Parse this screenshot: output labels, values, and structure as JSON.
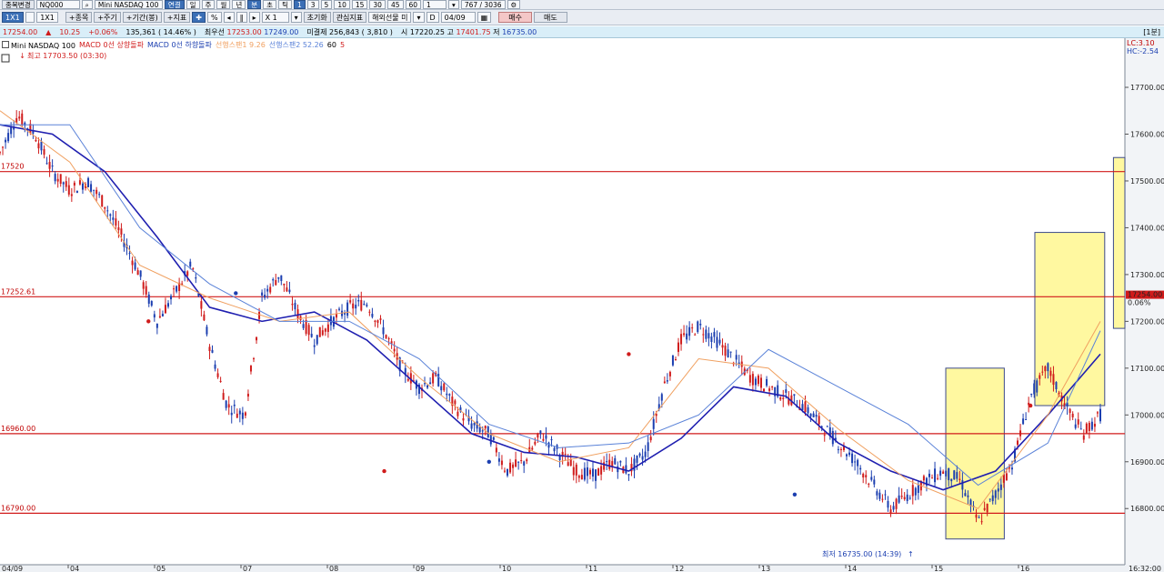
{
  "toolbar1": {
    "symbol_btn": "종목변경",
    "code": "NQ000",
    "name": "Mini NASDAQ 100",
    "tabs": [
      "연결",
      "일",
      "주",
      "월",
      "년",
      "분",
      "초",
      "틱"
    ],
    "minutes": [
      "1",
      "3",
      "5",
      "10",
      "15",
      "30",
      "45",
      "60"
    ],
    "period_value": "1",
    "count": "767 / 3036"
  },
  "toolbar2": {
    "layout1": "1X1",
    "layout2": "1X1",
    "add_series": "+종목",
    "add_period": "+주기",
    "add_range": "+기간(봉)",
    "add_indicator": "+지표",
    "percent": "%",
    "zoom": "X 1",
    "reset": "초기화",
    "watch": "관심지표",
    "overseas": "해외선물 미",
    "date_label": "D",
    "date_value": "04/09",
    "buy": "매수",
    "sell": "매도"
  },
  "quote": {
    "price": "17254.00",
    "arrow": "▲",
    "change": "10.25",
    "pct": "+0.06%",
    "volume": "135,361",
    "vol_ratio": "( 14.46% )",
    "bid_label": "최우선",
    "bid": "17253.00",
    "ask": "17249.00",
    "oi_label": "미결제",
    "oi": "256,843",
    "oi_chg": "( 3,810 )",
    "open_label": "시",
    "open": "17220.25",
    "high_label": "고",
    "high": "17401.75",
    "low_label": "저",
    "low": "16735.00",
    "period_tag": "[1분]"
  },
  "legend": {
    "name": "Mini NASDAQ 100",
    "macd_up": "MACD 0선 상향돌파",
    "macd_down": "MACD 0선 하향돌파",
    "span1": "선행스팬1 9.26",
    "span2": "선행스팬2 52.26",
    "p1": "60",
    "p2": "5"
  },
  "right_info": {
    "lc": "LC:3.10",
    "hc": "HC:-2.54"
  },
  "annotations": {
    "high": "최고 17703.50 (03:30)",
    "low": "최저 16735.00 (14:39)"
  },
  "colors": {
    "up": "#d01c1c",
    "down": "#1c3fb0",
    "ma": "#1f1fb0",
    "span1": "#f0a060",
    "span2": "#5a82d8",
    "hline": "#d11a1a",
    "highlight": "#fff8a0"
  },
  "chart_data": {
    "type": "line",
    "title": "",
    "xlabel": "",
    "ylabel": "",
    "ylim": [
      16700,
      17800
    ],
    "y_ticks": [
      16800,
      16900,
      17000,
      17100,
      17200,
      17300,
      17400,
      17500,
      17600,
      17700
    ],
    "y_tick_labels": [
      "16800.00",
      "16900.00",
      "17000.00",
      "17100.00",
      "17200.00",
      "17300.00",
      "17400.00",
      "17500.00",
      "17600.00",
      "17700.00"
    ],
    "x_ticks": [
      "04/09",
      "04",
      "05",
      "07",
      "08",
      "09",
      "10",
      "11",
      "12",
      "13",
      "14",
      "15",
      "16",
      "16:32:00"
    ],
    "horizontal_lines": [
      {
        "value": 17520,
        "label": "17520"
      },
      {
        "value": 17252.61,
        "label": "17252.61"
      },
      {
        "value": 16960,
        "label": "16960.00"
      },
      {
        "value": 16790,
        "label": "16790.00"
      }
    ],
    "current_price_label": "17254.00",
    "current_pct_label": "0.06%",
    "series": [
      {
        "name": "Mini NASDAQ 100",
        "x": [
          0,
          2,
          4,
          6,
          8,
          10,
          12,
          14,
          16,
          18,
          20,
          22,
          24,
          26,
          28,
          30,
          32,
          34,
          36,
          38,
          40,
          42,
          44,
          46,
          48,
          50,
          52,
          54,
          56,
          58,
          60,
          62,
          64,
          66,
          68,
          70,
          72,
          74,
          76,
          78,
          80,
          82,
          84,
          86,
          88,
          90,
          92,
          94,
          96,
          98,
          100,
          102,
          104,
          106,
          108,
          110,
          112,
          114,
          116,
          118,
          120,
          122,
          124,
          126
        ],
        "values": [
          17560,
          17640,
          17600,
          17520,
          17480,
          17500,
          17450,
          17380,
          17300,
          17200,
          17260,
          17320,
          17150,
          17020,
          17000,
          17250,
          17300,
          17220,
          17160,
          17200,
          17230,
          17240,
          17180,
          17100,
          17060,
          17080,
          17020,
          16980,
          16960,
          16880,
          16900,
          16960,
          16920,
          16880,
          16870,
          16900,
          16880,
          16920,
          17060,
          17160,
          17190,
          17160,
          17120,
          17080,
          17060,
          17040,
          17020,
          16980,
          16940,
          16900,
          16850,
          16800,
          16830,
          16860,
          16880,
          16860,
          16770,
          16830,
          16900,
          17040,
          17100,
          17020,
          16960,
          17000
        ]
      },
      {
        "name": "MA",
        "x": [
          0,
          6,
          12,
          18,
          24,
          30,
          36,
          42,
          48,
          54,
          60,
          66,
          72,
          78,
          84,
          90,
          96,
          102,
          108,
          114,
          120,
          126
        ],
        "values": [
          17620,
          17600,
          17520,
          17380,
          17230,
          17200,
          17220,
          17160,
          17060,
          16960,
          16920,
          16910,
          16880,
          16950,
          17060,
          17040,
          16940,
          16880,
          16840,
          16880,
          17000,
          17130
        ]
      },
      {
        "name": "선행스팬1",
        "x": [
          0,
          8,
          16,
          24,
          32,
          40,
          48,
          56,
          64,
          72,
          80,
          88,
          96,
          104,
          112,
          120,
          126
        ],
        "values": [
          17650,
          17540,
          17320,
          17250,
          17200,
          17220,
          17080,
          16960,
          16900,
          16930,
          17120,
          17100,
          16970,
          16860,
          16800,
          17000,
          17200
        ]
      },
      {
        "name": "선행스팬2",
        "x": [
          0,
          8,
          16,
          24,
          32,
          40,
          48,
          56,
          64,
          72,
          80,
          88,
          96,
          104,
          112,
          120,
          126
        ],
        "values": [
          17620,
          17620,
          17400,
          17280,
          17200,
          17200,
          17120,
          16980,
          16930,
          16940,
          17000,
          17140,
          17060,
          16980,
          16850,
          16940,
          17180
        ]
      }
    ]
  }
}
